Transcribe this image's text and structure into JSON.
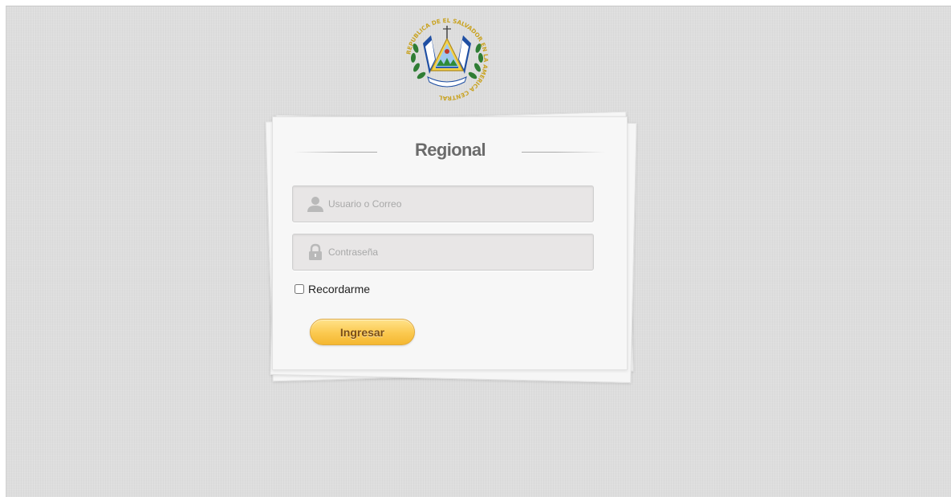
{
  "emblem": {
    "name": "coat-of-arms",
    "ring_text": "REPUBLICA DE EL SALVADOR EN LA AMERICA CENTRAL"
  },
  "login": {
    "title": "Regional",
    "username": {
      "icon": "user-icon",
      "placeholder": "Usuario o Correo",
      "value": ""
    },
    "password": {
      "icon": "lock-icon",
      "placeholder": "Contraseña",
      "value": ""
    },
    "remember_label": "Recordarme",
    "remember_checked": false,
    "submit_label": "Ingresar"
  },
  "colors": {
    "background": "#dedede",
    "card": "#f7f7f7",
    "button": "#fbc94f",
    "button_text": "#7a4e17",
    "title_text": "#6b6b6b"
  }
}
